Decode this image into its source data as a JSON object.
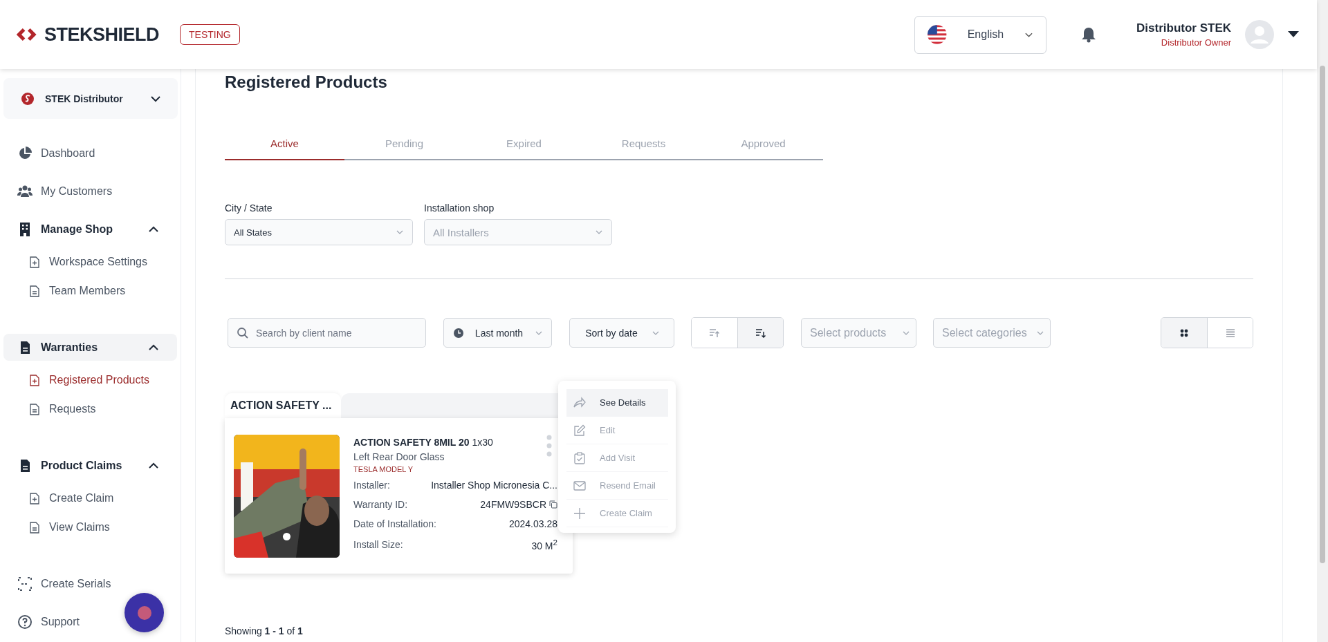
{
  "header": {
    "logo": "STEKSHIELD",
    "env_badge": "TESTING",
    "language": "English",
    "user_name": "Distributor STEK",
    "user_role": "Distributor Owner"
  },
  "sidebar": {
    "org": "STEK Distributor",
    "items": [
      {
        "kind": "link",
        "label": "Dashboard",
        "selected": false
      },
      {
        "kind": "link",
        "label": "My Customers",
        "selected": false
      },
      {
        "kind": "section",
        "label": "Manage Shop",
        "expanded": true,
        "selected": false,
        "children": [
          {
            "label": "Workspace Settings",
            "selected": false
          },
          {
            "label": "Team Members",
            "selected": false
          }
        ]
      },
      {
        "kind": "section",
        "label": "Warranties",
        "expanded": true,
        "selected": true,
        "children": [
          {
            "label": "Registered Products",
            "selected": true
          },
          {
            "label": "Requests",
            "selected": false
          }
        ]
      },
      {
        "kind": "section",
        "label": "Product Claims",
        "expanded": true,
        "selected": false,
        "children": [
          {
            "label": "Create Claim",
            "selected": false
          },
          {
            "label": "View Claims",
            "selected": false
          }
        ]
      },
      {
        "kind": "link",
        "label": "Create Serials",
        "selected": false
      },
      {
        "kind": "link",
        "label": "Support",
        "selected": false
      }
    ]
  },
  "page_title": "Registered Products",
  "tabs": [
    {
      "label": "Active",
      "selected": true
    },
    {
      "label": "Pending",
      "selected": false
    },
    {
      "label": "Expired",
      "selected": false
    },
    {
      "label": "Requests",
      "selected": false
    },
    {
      "label": "Approved",
      "selected": false
    }
  ],
  "filters": [
    {
      "label": "City / State",
      "value": "All States"
    },
    {
      "label": "Installation shop",
      "placeholder": "All Installers"
    }
  ],
  "toolbar": {
    "search": {
      "placeholder": "Search by client name"
    },
    "period": "Last month",
    "sort": "Sort by date",
    "sort_order": [
      {
        "selected": false
      },
      {
        "selected": true
      }
    ],
    "products": {
      "placeholder": "Select products"
    },
    "categories": {
      "placeholder": "Select categories"
    },
    "view": [
      {
        "selected": true
      },
      {
        "selected": false
      }
    ]
  },
  "groups": [
    {
      "title": "ACTION SAFETY ...",
      "cards": [
        {
          "product": "**ACTION SAFETY 8MIL 20** 1x30",
          "location": "Left Rear Door Glass",
          "vehicle": "TESLA MODEL Y",
          "details": [
            {
              "label": "Installer:",
              "value": "Installer Shop Micronesia C..."
            },
            {
              "label": "Warranty ID:",
              "value": "24FMW9SBCR",
              "copy": true
            },
            {
              "label": "Date of Installation:",
              "value": "2024.03.28"
            },
            {
              "label": "Install Size:",
              "value": "30 M$^{2}$"
            }
          ]
        }
      ]
    }
  ],
  "menu": [
    {
      "label": "See Details",
      "selected": true,
      "disabled": false
    },
    {
      "label": "Edit",
      "selected": false,
      "disabled": true
    },
    {
      "label": "Add Visit",
      "selected": false,
      "disabled": true
    },
    {
      "label": "Resend Email",
      "selected": false,
      "disabled": true
    },
    {
      "label": "Create Claim",
      "selected": false,
      "disabled": true
    }
  ],
  "footer": "Showing **1 - 1** of **1**"
}
